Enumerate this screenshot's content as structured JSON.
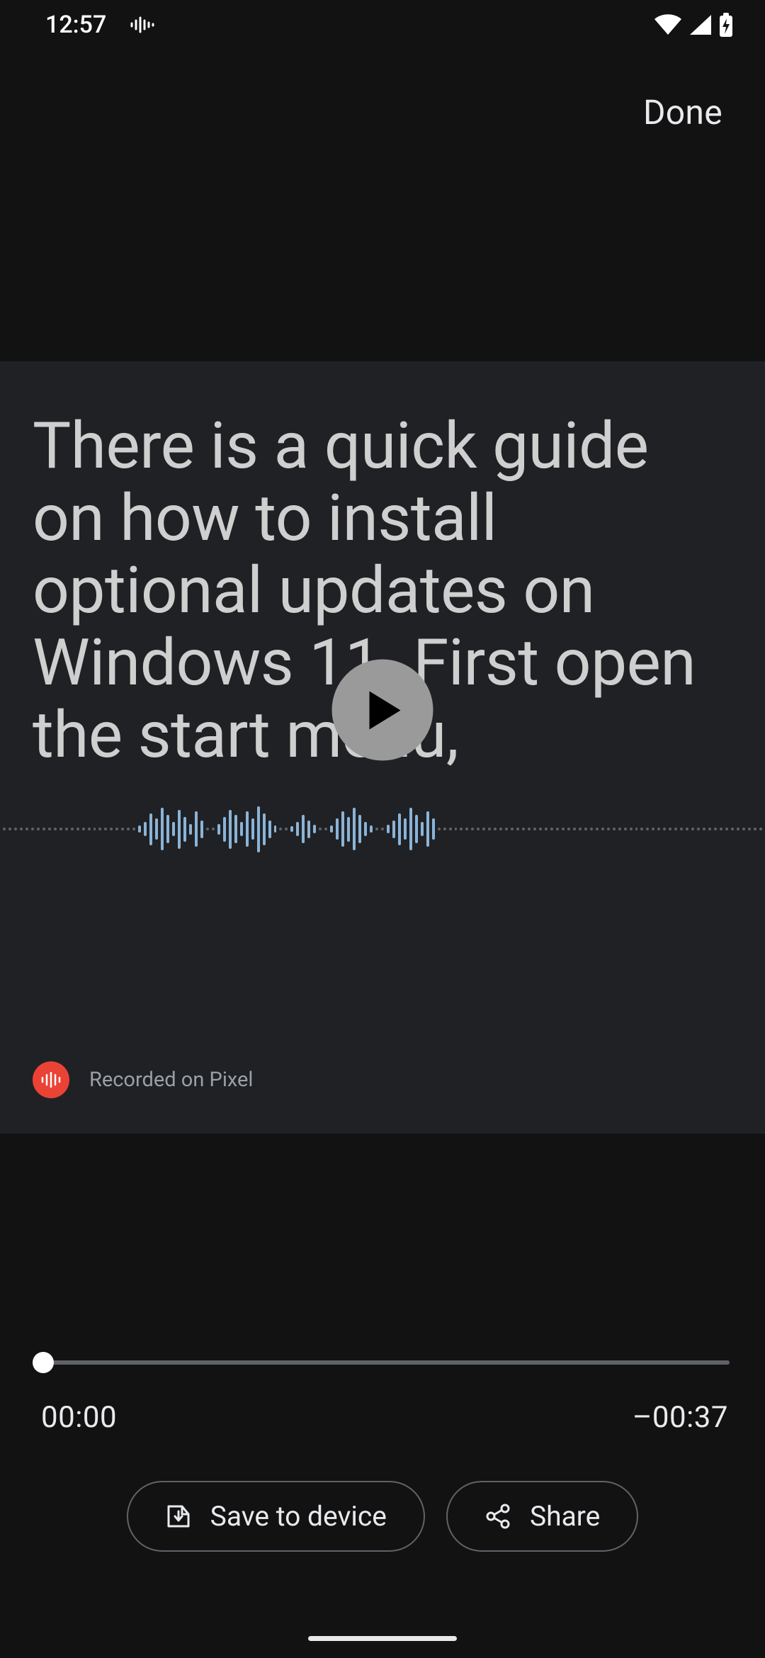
{
  "status": {
    "time": "12:57"
  },
  "header": {
    "done_label": "Done"
  },
  "player": {
    "transcript": "There is a quick guide on how to install optional updates on Windows 11. First open the start menu,",
    "recorded_label": "Recorded on Pixel"
  },
  "timeline": {
    "current": "00:00",
    "remaining": "–00:37",
    "progress_percent": 0
  },
  "actions": {
    "save_label": "Save to device",
    "share_label": "Share"
  },
  "colors": {
    "background": "#121212",
    "card_bg": "#202124",
    "accent_play": "#9a9a9a",
    "recorder_red": "#ea4335",
    "waveform_bar": "#8ab4d8"
  }
}
